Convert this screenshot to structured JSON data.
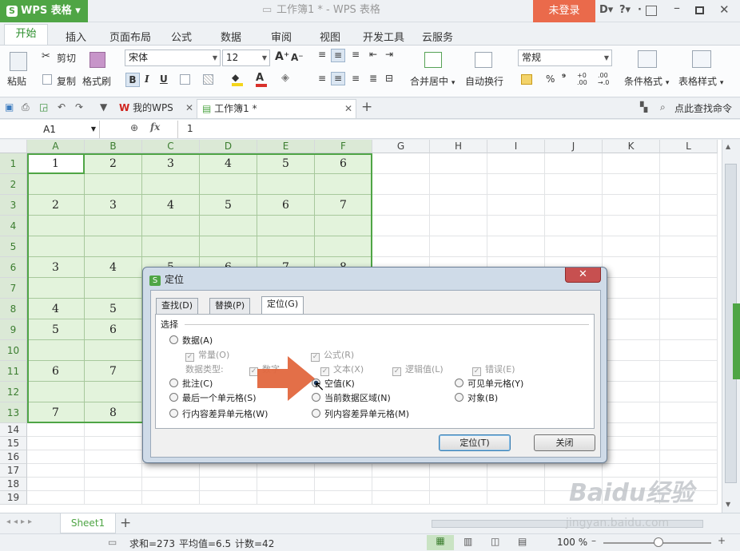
{
  "app": {
    "logo": "WPS 表格",
    "window_title": "工作簿1 * - WPS 表格",
    "login": "未登录"
  },
  "titlebar_icons": {
    "skin": "D▾",
    "help": "?▾",
    "more": "·"
  },
  "menu": [
    "开始",
    "插入",
    "页面布局",
    "公式",
    "数据",
    "审阅",
    "视图",
    "开发工具",
    "云服务"
  ],
  "ribbon": {
    "paste": "粘贴",
    "cut": "剪切",
    "copy": "复制",
    "format_painter": "格式刷",
    "font_name": "宋体",
    "font_size": "12",
    "bold": "B",
    "italic": "I",
    "underline": "U",
    "merge": "合并居中",
    "wrap": "自动换行",
    "number_format": "常规",
    "percent": "%",
    "thousands": "⁹",
    "cond_format": "条件格式",
    "table_style": "表格样式"
  },
  "tabs": {
    "wps_tab": "我的WPS",
    "doc_tab": "工作簿1 *",
    "find_cmd": "点此查找命令"
  },
  "formula": {
    "name_box": "A1",
    "fx": "fx",
    "value": "1"
  },
  "columns": [
    "A",
    "B",
    "C",
    "D",
    "E",
    "F",
    "G",
    "H",
    "I",
    "J",
    "K",
    "L"
  ],
  "rows": [
    "1",
    "2",
    "3",
    "4",
    "5",
    "6",
    "7",
    "8",
    "9",
    "10",
    "11",
    "12",
    "13",
    "14",
    "15",
    "16",
    "17",
    "18",
    "19"
  ],
  "cells": {
    "1": [
      "1",
      "2",
      "3",
      "4",
      "5",
      "6"
    ],
    "3": [
      "2",
      "3",
      "4",
      "5",
      "6",
      "7"
    ],
    "6": [
      "3",
      "4",
      "5",
      "6",
      "7",
      "8"
    ],
    "8": [
      "4",
      "5"
    ],
    "9": [
      "5",
      "6"
    ],
    "11": [
      "6",
      "7"
    ],
    "13": [
      "7",
      "8"
    ]
  },
  "sheet": {
    "tab": "Sheet1"
  },
  "status": {
    "sum": "求和=273",
    "avg": "平均值=6.5",
    "count": "计数=42",
    "zoom": "100 %"
  },
  "dialog": {
    "title": "定位",
    "tabs": [
      "查找(D)",
      "替换(P)",
      "定位(G)"
    ],
    "group": "选择",
    "data": "数据(A)",
    "const": "常量(O)",
    "formula": "公式(R)",
    "data_types": "数据类型:",
    "number": "数字",
    "text": "文本(X)",
    "logical": "逻辑值(L)",
    "error": "错误(E)",
    "comment": "批注(C)",
    "blank": "空值(K)",
    "visible": "可见单元格(Y)",
    "last_cell": "最后一个单元格(S)",
    "current_region": "当前数据区域(N)",
    "objects": "对象(B)",
    "row_diff": "行内容差异单元格(W)",
    "col_diff": "列内容差异单元格(M)",
    "ok": "定位(T)",
    "close": "关闭"
  },
  "watermark": {
    "brand": "Baidu经验",
    "url": "jingyan.baidu.com"
  }
}
